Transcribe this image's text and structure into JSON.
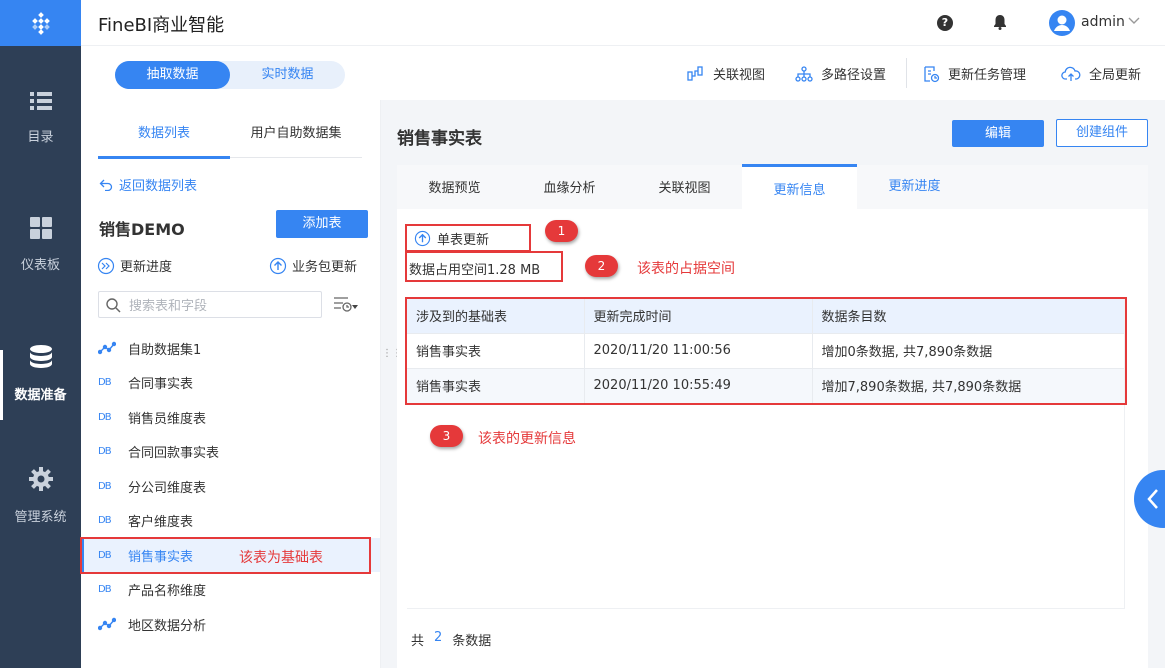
{
  "app": {
    "title": "FineBI商业智能",
    "user": "admin"
  },
  "nav": {
    "items": [
      {
        "label": "目录",
        "icon": "list-icon"
      },
      {
        "label": "仪表板",
        "icon": "dashboard-icon"
      },
      {
        "label": "数据准备",
        "icon": "database-icon",
        "active": true
      },
      {
        "label": "管理系统",
        "icon": "gear-icon"
      }
    ]
  },
  "toolbar": {
    "seg_extract": "抽取数据",
    "seg_realtime": "实时数据",
    "relation_view": "关联视图",
    "multipath": "多路径设置",
    "update_task": "更新任务管理",
    "global_update": "全局更新"
  },
  "left": {
    "tab_list": "数据列表",
    "tab_self": "用户自助数据集",
    "back": "返回数据列表",
    "package": "销售DEMO",
    "add_table": "添加表",
    "progress": "更新进度",
    "package_update": "业务包更新",
    "search_placeholder": "搜索表和字段",
    "tables": [
      "自助数据集1",
      "合同事实表",
      "销售员维度表",
      "合同回款事实表",
      "分公司维度表",
      "客户维度表",
      "销售事实表",
      "产品名称维度",
      "地区数据分析"
    ]
  },
  "right": {
    "title": "销售事实表",
    "edit": "编辑",
    "create": "创建组件",
    "tabs": [
      "数据预览",
      "血缘分析",
      "关联视图",
      "更新信息",
      "更新进度"
    ],
    "single_update": "单表更新",
    "space": "数据占用空间1.28 MB",
    "table": {
      "headers": [
        "涉及到的基础表",
        "更新完成时间",
        "数据条目数"
      ],
      "rows": [
        [
          "销售事实表",
          "2020/11/20 11:00:56",
          "增加0条数据, 共7,890条数据"
        ],
        [
          "销售事实表",
          "2020/11/20 10:55:49",
          "增加7,890条数据, 共7,890条数据"
        ]
      ]
    },
    "footer": {
      "prefix": "共",
      "count": "2",
      "suffix": "条数据"
    }
  },
  "annotations": {
    "badge1": "1",
    "badge2": "2",
    "badge3": "3",
    "note_space": "该表的占据空间",
    "note_update": "该表的更新信息",
    "note_base": "该表为基础表"
  },
  "colors": {
    "accent": "#3685f2",
    "nav_bg": "#2e3f56",
    "annotation": "#e5393a"
  }
}
